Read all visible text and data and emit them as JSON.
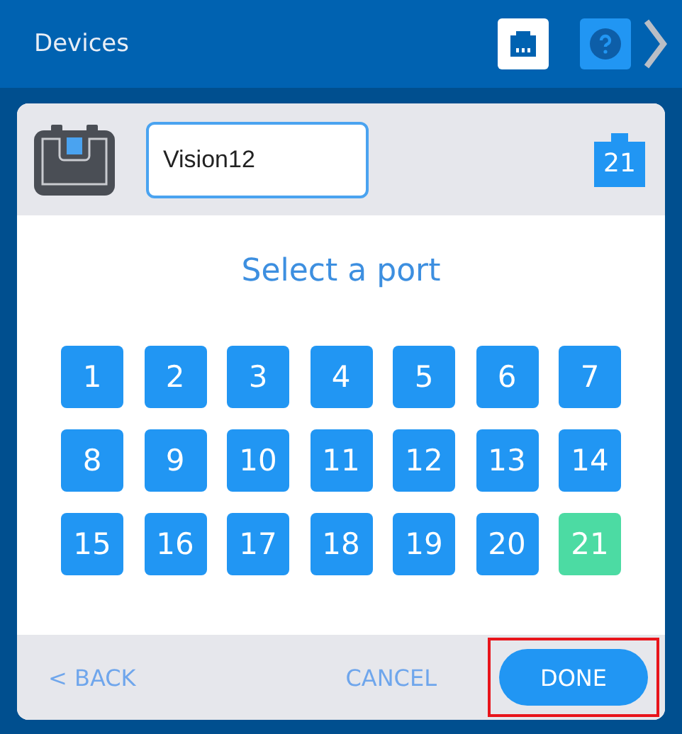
{
  "header": {
    "title": "Devices"
  },
  "device": {
    "name": "Vision12",
    "port_badge": "21"
  },
  "prompt": "Select a port",
  "ports": [
    {
      "label": "1",
      "selected": false
    },
    {
      "label": "2",
      "selected": false
    },
    {
      "label": "3",
      "selected": false
    },
    {
      "label": "4",
      "selected": false
    },
    {
      "label": "5",
      "selected": false
    },
    {
      "label": "6",
      "selected": false
    },
    {
      "label": "7",
      "selected": false
    },
    {
      "label": "8",
      "selected": false
    },
    {
      "label": "9",
      "selected": false
    },
    {
      "label": "10",
      "selected": false
    },
    {
      "label": "11",
      "selected": false
    },
    {
      "label": "12",
      "selected": false
    },
    {
      "label": "13",
      "selected": false
    },
    {
      "label": "14",
      "selected": false
    },
    {
      "label": "15",
      "selected": false
    },
    {
      "label": "16",
      "selected": false
    },
    {
      "label": "17",
      "selected": false
    },
    {
      "label": "18",
      "selected": false
    },
    {
      "label": "19",
      "selected": false
    },
    {
      "label": "20",
      "selected": false
    },
    {
      "label": "21",
      "selected": true
    }
  ],
  "footer": {
    "back": "< BACK",
    "cancel": "CANCEL",
    "done": "DONE",
    "done_highlighted": true
  }
}
